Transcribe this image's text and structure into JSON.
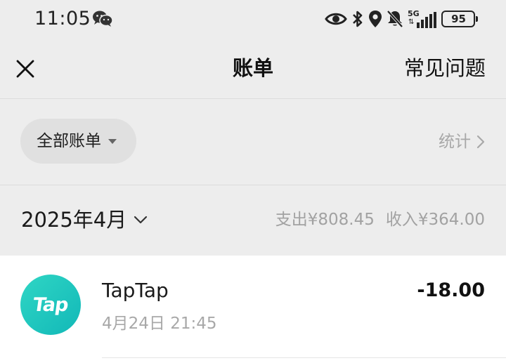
{
  "status_bar": {
    "time": "11:05",
    "network": "5G",
    "battery": "95",
    "icons": [
      "wechat-icon",
      "eye-icon",
      "bluetooth-icon",
      "location-icon",
      "bell-muted-icon",
      "signal-icon",
      "battery-icon"
    ]
  },
  "nav": {
    "close_icon": "close-icon",
    "title": "账单",
    "faq_label": "常见问题"
  },
  "filter": {
    "label": "全部账单",
    "stats_label": "统计"
  },
  "month": {
    "label": "2025年4月",
    "expense": "支出¥808.45",
    "income": "收入¥364.00"
  },
  "transactions": [
    {
      "icon_text": "Tap",
      "name": "TapTap",
      "time": "4月24日 21:45",
      "amount": "-18.00"
    }
  ],
  "colors": {
    "background": "#ededed",
    "list_background": "#ffffff",
    "secondary_text": "#a8a8a8",
    "app_icon": "#1fc6bd"
  }
}
